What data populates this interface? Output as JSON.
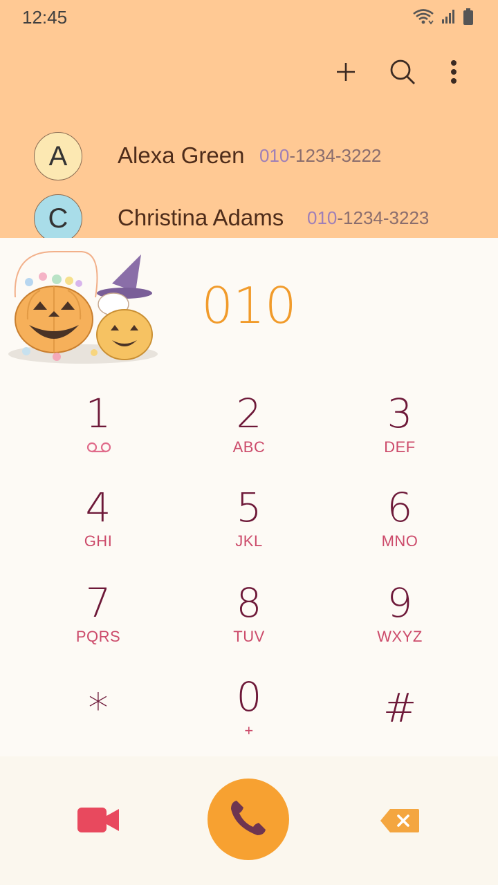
{
  "status_bar": {
    "time": "12:45"
  },
  "toolbar": {
    "add_icon": "plus-icon",
    "search_icon": "search-icon",
    "more_icon": "more-vertical-icon"
  },
  "suggestions": [
    {
      "initial": "A",
      "name": "Alexa Green",
      "number_match": "010",
      "number_rest": "-1234-3222",
      "avatar_color": "#fce8b2"
    },
    {
      "initial": "C",
      "name": "Christina Adams",
      "number_match": "010",
      "number_rest": "-1234-3223",
      "avatar_color": "#a9dde9"
    }
  ],
  "dialer": {
    "typed_number": "010",
    "keys": [
      {
        "digit": "1",
        "letters": ""
      },
      {
        "digit": "2",
        "letters": "ABC"
      },
      {
        "digit": "3",
        "letters": "DEF"
      },
      {
        "digit": "4",
        "letters": "GHI"
      },
      {
        "digit": "5",
        "letters": "JKL"
      },
      {
        "digit": "6",
        "letters": "MNO"
      },
      {
        "digit": "7",
        "letters": "PQRS"
      },
      {
        "digit": "8",
        "letters": "TUV"
      },
      {
        "digit": "9",
        "letters": "WXYZ"
      },
      {
        "digit": "*",
        "letters": ""
      },
      {
        "digit": "0",
        "letters": "+"
      },
      {
        "digit": "#",
        "letters": ""
      }
    ]
  },
  "actions": {
    "video_call_icon": "video-camera-icon",
    "call_icon": "phone-icon",
    "delete_icon": "backspace-icon"
  },
  "colors": {
    "header_bg": "#ffc994",
    "accent": "#f7a131",
    "digit": "#6d1838",
    "letters": "#cc4a6a"
  }
}
